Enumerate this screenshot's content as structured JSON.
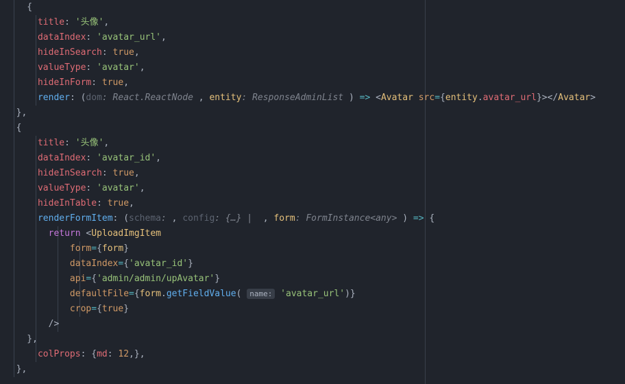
{
  "editor": {
    "language": "TypeScript JSX",
    "theme": "One Dark",
    "indentGuides": true
  },
  "lines": {
    "l0": "  {",
    "l1_prop1": "title",
    "l1_val": "'头像'",
    "l2_prop": "dataIndex",
    "l2_val": "'avatar_url'",
    "l3_prop": "hideInSearch",
    "l3_val": "true",
    "l4_prop": "valueType",
    "l4_val": "'avatar'",
    "l5_prop": "hideInForm",
    "l5_val": "true",
    "l6_prop": "render",
    "l6_p1": "dom",
    "l6_t1": ": React.ReactNode ",
    "l6_p2": "entity",
    "l6_t2": ": ResponseAdminList ",
    "l6_comp": "Avatar",
    "l6_attr": "src",
    "l6_ent": "entity",
    "l6_fld": "avatar_url",
    "l7": "  },",
    "l8": "  {",
    "l9_prop": "title",
    "l9_val": "'头像'",
    "l10_prop": "dataIndex",
    "l10_val": "'avatar_id'",
    "l11_prop": "hideInSearch",
    "l11_val": "true",
    "l12_prop": "valueType",
    "l12_val": "'avatar'",
    "l13_prop": "hideInTable",
    "l13_val": "true",
    "l14_prop": "renderFormItem",
    "l14_p1": "schema",
    "l14_t1": ": ",
    "l14_p2": "config",
    "l14_t2": ": {…} |  ",
    "l14_p3": "form",
    "l14_t3": ": FormInstance<any> ",
    "l15_ret": "return",
    "l15_comp": "UploadImgItem",
    "l16_attr": "form",
    "l16_val": "form",
    "l17_attr": "dataIndex",
    "l17_val": "'avatar_id'",
    "l18_attr": "api",
    "l18_val": "'admin/admin/upAvatar'",
    "l19_attr": "defaultFile",
    "l19_obj": "form",
    "l19_fn": "getFieldValue",
    "l19_hint": "name:",
    "l19_arg": "'avatar_url'",
    "l20_attr": "crop",
    "l20_val": "true",
    "l21": "        />",
    "l22": "    },",
    "l23_prop": "colProps",
    "l23_md": "md",
    "l23_num": "12",
    "l24": "  },"
  }
}
